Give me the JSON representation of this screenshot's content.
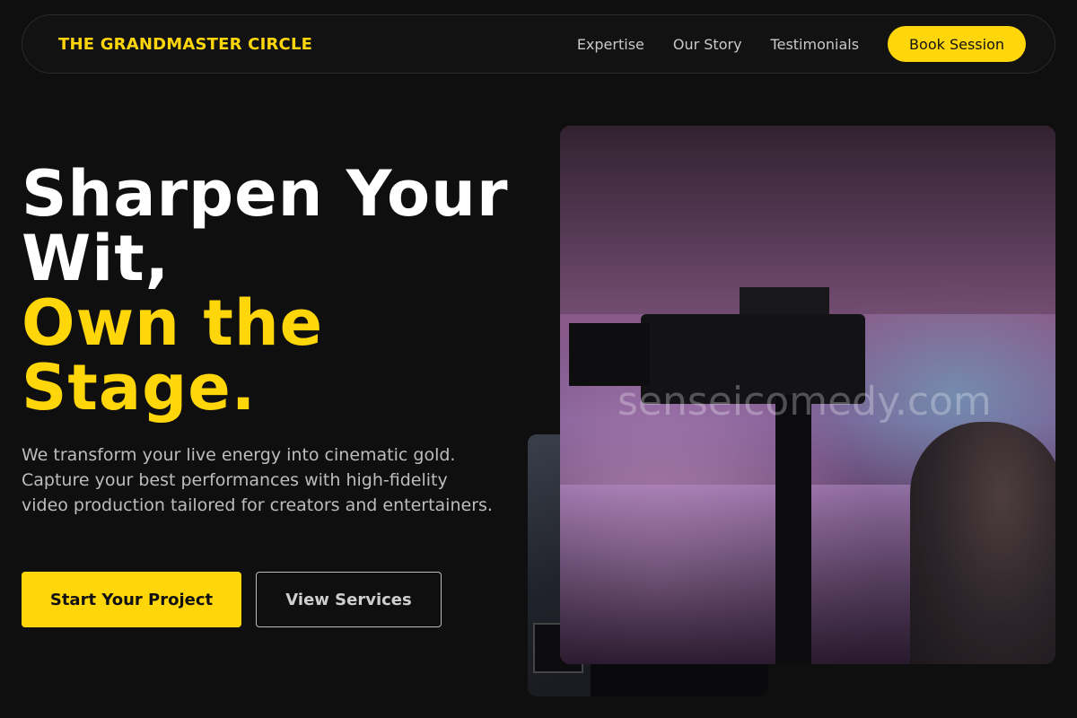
{
  "nav": {
    "brand": "THE GRANDMASTER CIRCLE",
    "links": [
      {
        "label": "Expertise"
      },
      {
        "label": "Our Story"
      },
      {
        "label": "Testimonials"
      }
    ],
    "cta": "Book Session"
  },
  "hero": {
    "headline_line1": "Sharpen Your",
    "headline_line2": "Wit,",
    "headline_line3": "Own the",
    "headline_line4": "Stage.",
    "subtext": "We transform your live energy into cinematic gold. Capture your best performances with high-fidelity video production tailored for creators and entertainers.",
    "primary_button": "Start Your Project",
    "secondary_button": "View Services"
  },
  "media": {
    "watermark": "senseicomedy.com"
  },
  "colors": {
    "background": "#0f0f10",
    "accent": "#ffd60a",
    "text_muted": "#bdbdbd"
  }
}
